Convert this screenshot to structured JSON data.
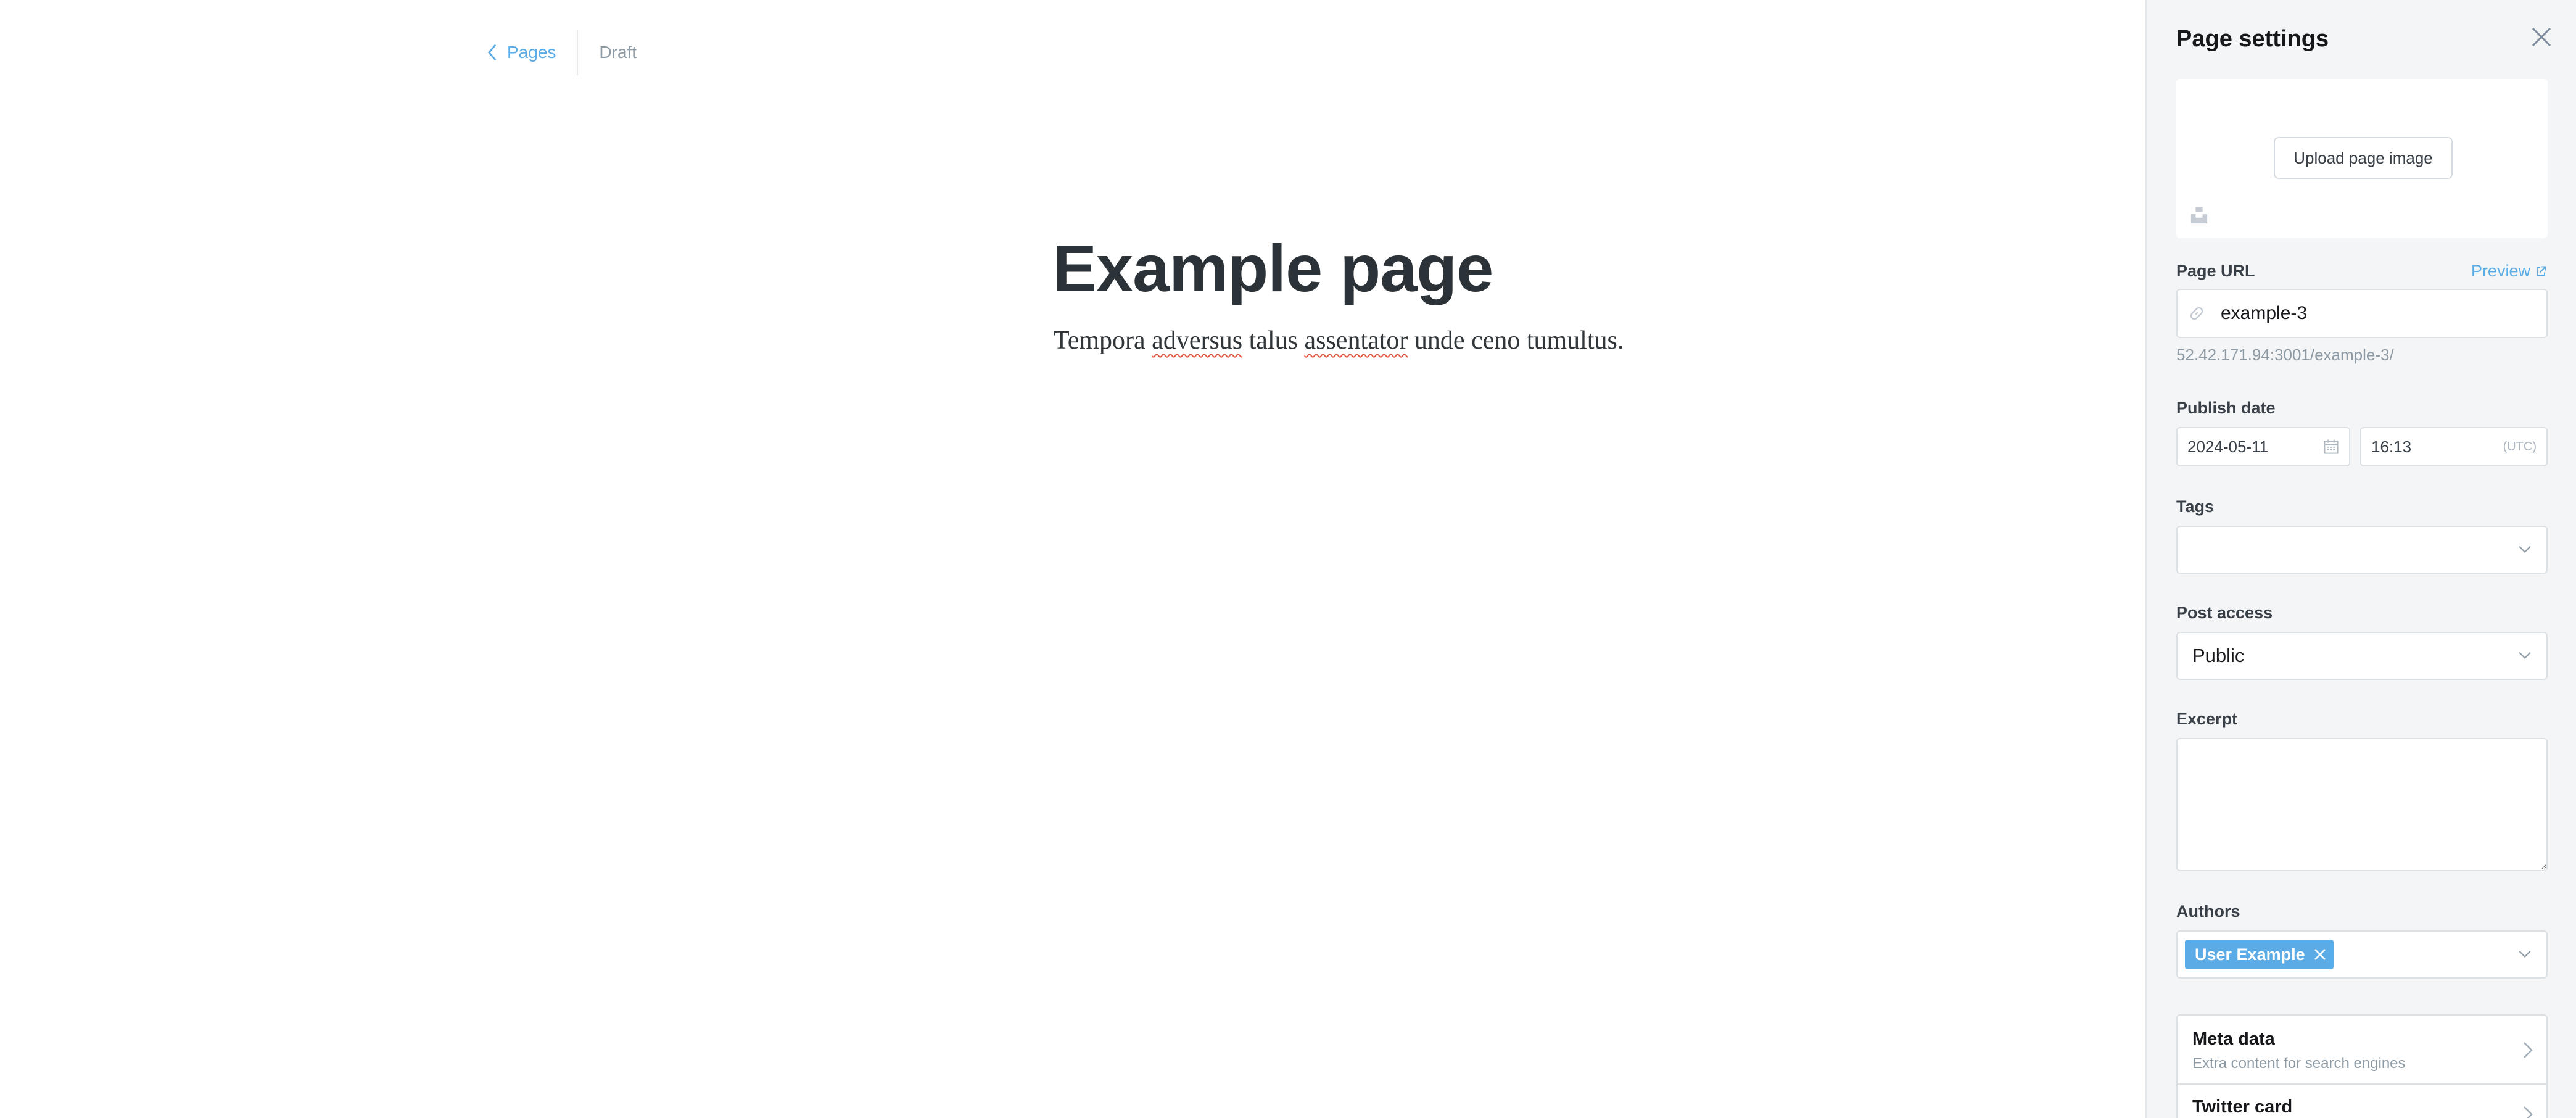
{
  "editor": {
    "back_label": "Pages",
    "status": "Draft",
    "title": "Example page",
    "body_parts": [
      "Tempora ",
      "adversus",
      " talus ",
      "assentator",
      " unde ceno tumultus."
    ]
  },
  "panel": {
    "title": "Page settings",
    "upload_label": "Upload page image",
    "url": {
      "label": "Page URL",
      "preview_label": "Preview",
      "value": "example-3",
      "hint": "52.42.171.94:3001/example-3/"
    },
    "publish": {
      "label": "Publish date",
      "date": "2024-05-11",
      "time": "16:13",
      "timezone": "(UTC)"
    },
    "tags": {
      "label": "Tags",
      "value": ""
    },
    "access": {
      "label": "Post access",
      "value": "Public"
    },
    "excerpt": {
      "label": "Excerpt",
      "value": ""
    },
    "authors": {
      "label": "Authors",
      "items": [
        "User Example"
      ]
    },
    "meta": {
      "title": "Meta data",
      "subtitle": "Extra content for search engines"
    },
    "twitter": {
      "title": "Twitter card"
    }
  },
  "colors": {
    "accent": "#5aabe6",
    "panel_bg": "#f4f5f6",
    "title_text": "#2c3338",
    "muted_text": "#8e9aa3"
  },
  "icons": [
    "chevron-left-icon",
    "close-icon",
    "unsplash-icon",
    "external-link-icon",
    "link-icon",
    "calendar-icon",
    "chevron-down-icon",
    "remove-icon",
    "chevron-right-icon"
  ]
}
